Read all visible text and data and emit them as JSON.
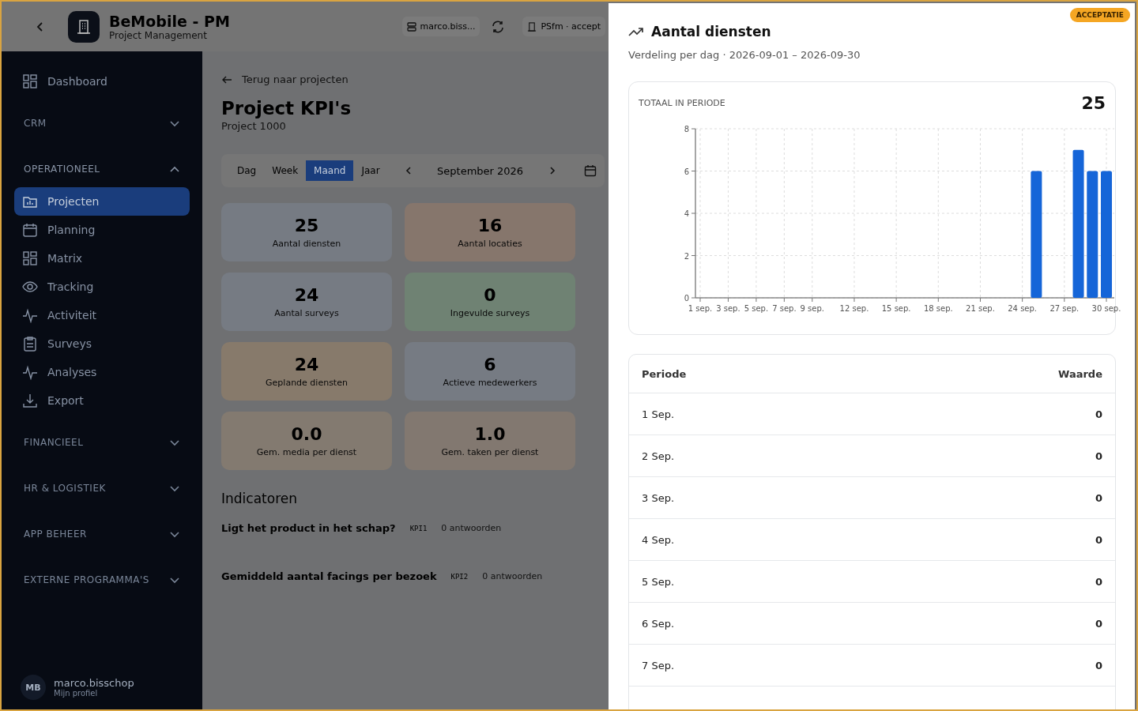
{
  "header": {
    "app_title": "BeMobile - PM",
    "app_subtitle": "Project Management",
    "user_chip": "marco.biss...",
    "tenant_chip": "PSfm · accept"
  },
  "sidebar": {
    "items": [
      {
        "kind": "link",
        "label": "Dashboard",
        "selected": false
      },
      {
        "kind": "section",
        "label": "CRM",
        "expanded": false
      },
      {
        "kind": "section",
        "label": "OPERATIONEEL",
        "expanded": true
      },
      {
        "kind": "link",
        "label": "Projecten",
        "selected": true
      },
      {
        "kind": "link",
        "label": "Planning",
        "selected": false
      },
      {
        "kind": "link",
        "label": "Matrix",
        "selected": false
      },
      {
        "kind": "link",
        "label": "Tracking",
        "selected": false
      },
      {
        "kind": "link",
        "label": "Activiteit",
        "selected": false
      },
      {
        "kind": "link",
        "label": "Surveys",
        "selected": false
      },
      {
        "kind": "link",
        "label": "Analyses",
        "selected": false
      },
      {
        "kind": "link",
        "label": "Export",
        "selected": false
      },
      {
        "kind": "section",
        "label": "FINANCIEEL",
        "expanded": false
      },
      {
        "kind": "section",
        "label": "HR & LOGISTIEK",
        "expanded": false
      },
      {
        "kind": "section",
        "label": "APP BEHEER",
        "expanded": false
      },
      {
        "kind": "section",
        "label": "EXTERNE PROGRAMMA'S",
        "expanded": false
      }
    ],
    "profile": {
      "initials": "MB",
      "name": "marco.bisschop",
      "link": "Mijn profiel"
    }
  },
  "main": {
    "back_link": "Terug naar projecten",
    "title": "Project KPI's",
    "subtitle": "Project 1000",
    "period_tabs": [
      {
        "label": "Dag",
        "selected": false
      },
      {
        "label": "Week",
        "selected": false
      },
      {
        "label": "Maand",
        "selected": true
      },
      {
        "label": "Jaar",
        "selected": false
      }
    ],
    "period": "September 2026",
    "kpi_cards": [
      {
        "value": "25",
        "label": "Aantal diensten",
        "color": "#767b83"
      },
      {
        "value": "16",
        "label": "Aantal locaties",
        "color": "#86766c"
      },
      {
        "value": "24",
        "label": "Aantal surveys",
        "color": "#767b83"
      },
      {
        "value": "0",
        "label": "Ingevulde surveys",
        "color": "#6f8273"
      },
      {
        "value": "24",
        "label": "Geplande diensten",
        "color": "#877a6b"
      },
      {
        "value": "6",
        "label": "Actieve medewerkers",
        "color": "#767b83"
      },
      {
        "value": "0.0",
        "label": "Gem. media per dienst",
        "color": "#837a70"
      },
      {
        "value": "1.0",
        "label": "Gem. taken per dienst",
        "color": "#827870"
      }
    ],
    "indicators_title": "Indicatoren",
    "indicators": [
      {
        "question": "Ligt het product in het schap?",
        "code": "KPI1",
        "answers": "0 antwoorden"
      },
      {
        "question": "Gemiddeld aantal facings per bezoek",
        "code": "KPI2",
        "answers": "0 antwoorden"
      }
    ]
  },
  "drawer": {
    "environment_badge": "ACCEPTATIE",
    "title": "Aantal diensten",
    "subtitle": "Verdeling per dag · 2026-09-01 – 2026-09-30",
    "total_label": "TOTAAL IN PERIODE",
    "total_value": "25",
    "chart_data": {
      "type": "bar",
      "grid": true,
      "categories": [
        "1 sep.",
        null,
        "3 sep.",
        null,
        "5 sep.",
        null,
        "7 sep.",
        null,
        "9 sep.",
        null,
        null,
        "12 sep.",
        null,
        null,
        "15 sep.",
        null,
        null,
        "18 sep.",
        null,
        null,
        "21 sep.",
        null,
        null,
        "24 sep.",
        null,
        null,
        "27 sep.",
        null,
        null,
        "30 sep."
      ],
      "series": [
        {
          "color": "#1565d8",
          "values": [
            0,
            0,
            0,
            0,
            0,
            0,
            0,
            0,
            0,
            0,
            0,
            0,
            0,
            0,
            0,
            0,
            0,
            0,
            0,
            0,
            0,
            0,
            0,
            0,
            6,
            0,
            0,
            7,
            6,
            6
          ]
        }
      ],
      "ylim": [
        0,
        8
      ],
      "yticks": [
        0,
        2,
        4,
        6,
        8
      ]
    },
    "table": {
      "columns": [
        "Periode",
        "Waarde"
      ],
      "rows": [
        {
          "period": "1 Sep.",
          "value": "0"
        },
        {
          "period": "2 Sep.",
          "value": "0"
        },
        {
          "period": "3 Sep.",
          "value": "0"
        },
        {
          "period": "4 Sep.",
          "value": "0"
        },
        {
          "period": "5 Sep.",
          "value": "0"
        },
        {
          "period": "6 Sep.",
          "value": "0"
        },
        {
          "period": "7 Sep.",
          "value": "0"
        }
      ]
    }
  }
}
